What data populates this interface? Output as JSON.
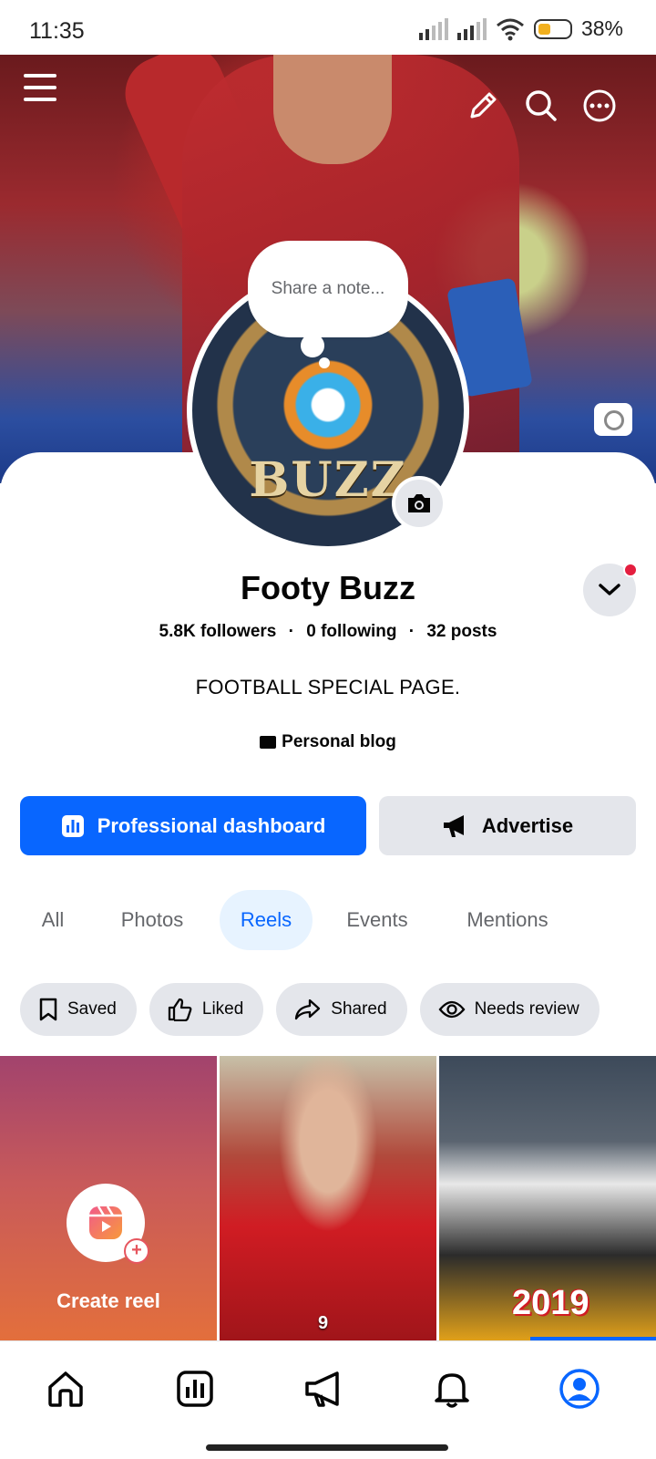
{
  "status_bar": {
    "time": "11:35",
    "battery": "38%"
  },
  "header": {
    "menu_icon": "hamburger-icon",
    "edit_icon": "pencil-icon",
    "search_icon": "search-icon",
    "more_icon": "more-horizontal-icon"
  },
  "note": {
    "placeholder": "Share a note..."
  },
  "profile": {
    "avatar_text": "BUZZ",
    "name": "Footy Buzz",
    "followers": "5.8K followers",
    "following": "0 following",
    "posts": "32 posts",
    "bio": "FOOTBALL SPECIAL PAGE.",
    "category": "Personal blog"
  },
  "actions": {
    "dashboard_label": "Professional dashboard",
    "advertise_label": "Advertise"
  },
  "tabs": [
    {
      "label": "All",
      "active": false
    },
    {
      "label": "Photos",
      "active": false
    },
    {
      "label": "Reels",
      "active": true
    },
    {
      "label": "Events",
      "active": false
    },
    {
      "label": "Mentions",
      "active": false
    }
  ],
  "filters": [
    {
      "label": "Saved",
      "icon": "bookmark-icon"
    },
    {
      "label": "Liked",
      "icon": "thumbs-up-icon"
    },
    {
      "label": "Shared",
      "icon": "share-icon"
    },
    {
      "label": "Needs review",
      "icon": "eye-icon"
    }
  ],
  "reels": {
    "create_label": "Create reel",
    "items": [
      {
        "badge": "9"
      },
      {
        "badge": "2019"
      }
    ]
  },
  "colors": {
    "brand": "#0866ff",
    "chip_bg": "#e4e6eb",
    "notification": "#e41e3f"
  },
  "bottom_nav": [
    "home-icon",
    "dashboard-icon",
    "megaphone-icon",
    "bell-icon",
    "profile-icon"
  ]
}
